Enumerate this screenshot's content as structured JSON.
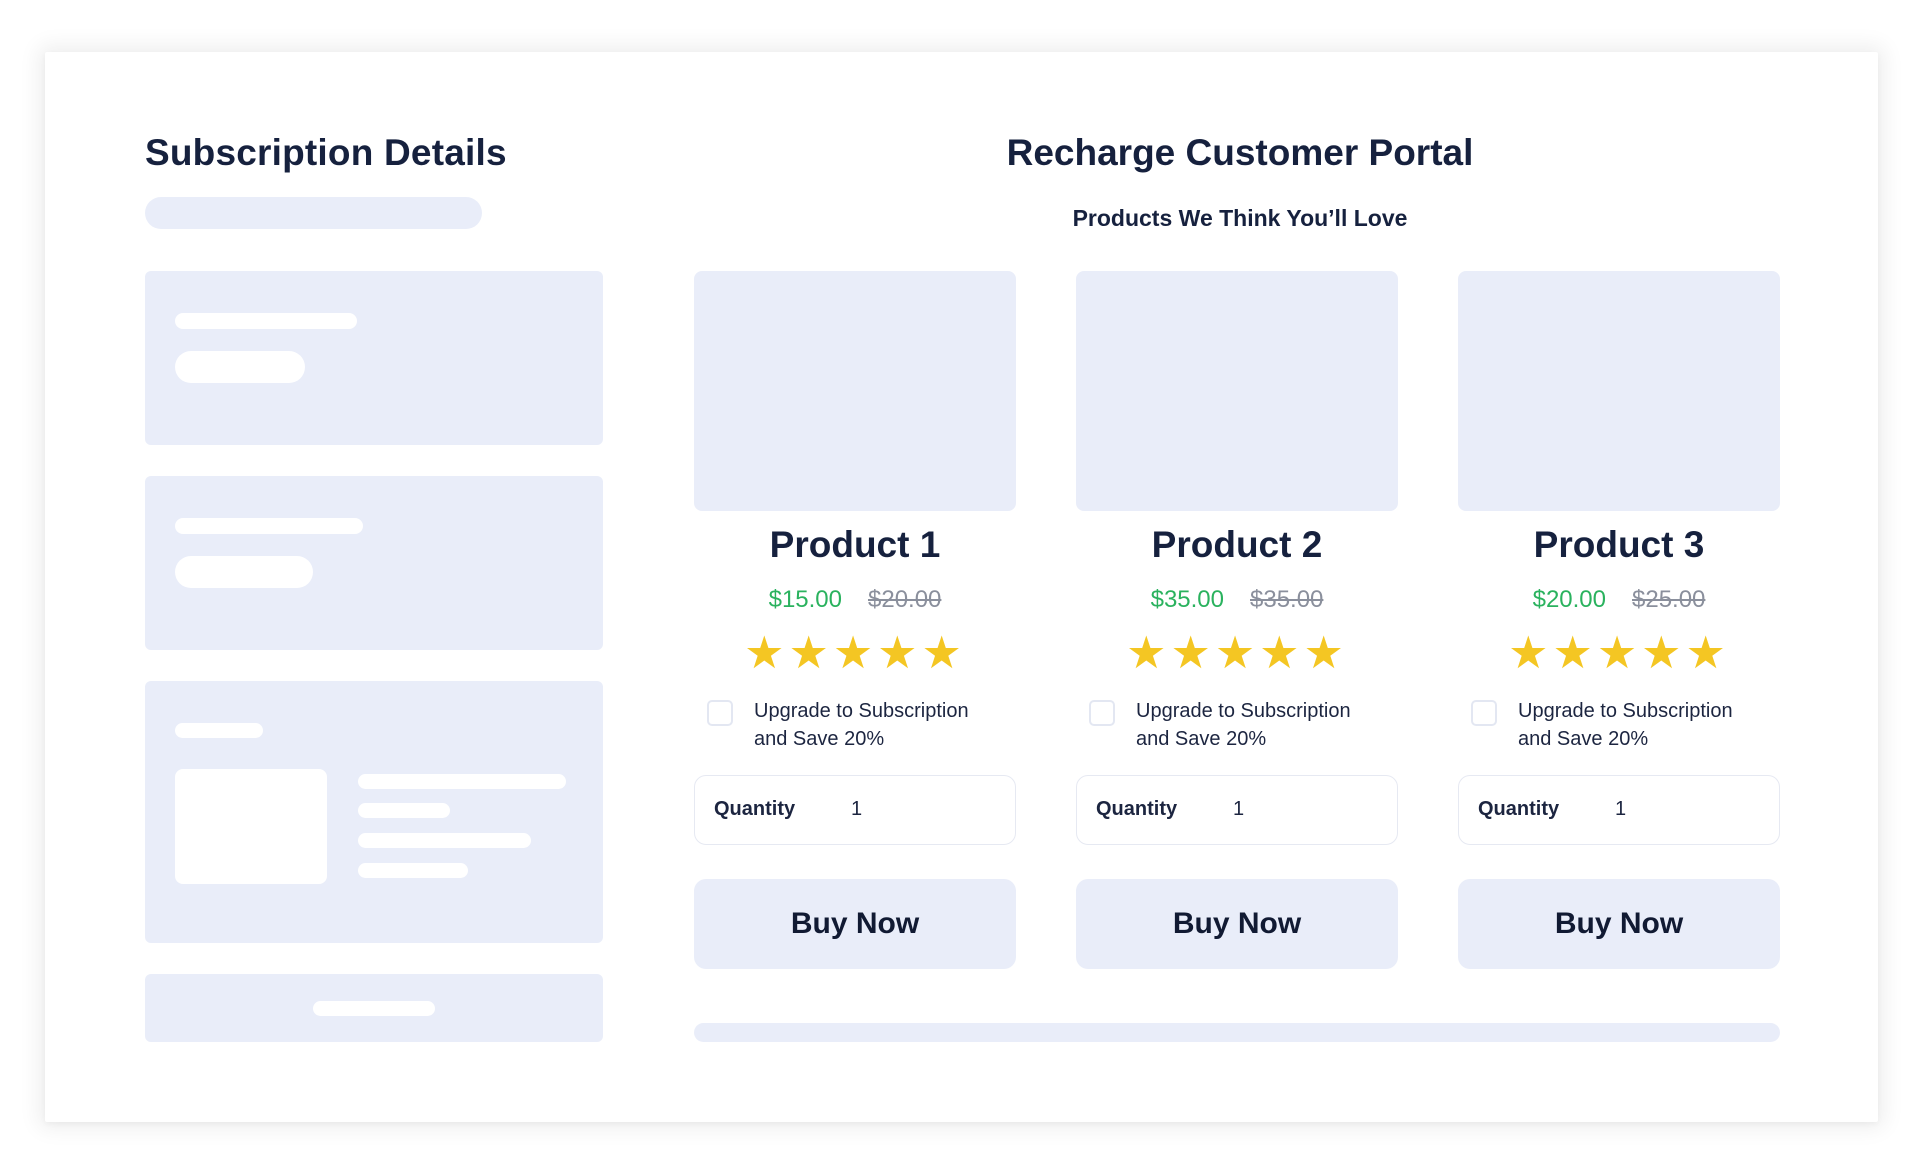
{
  "sidebar": {
    "title": "Subscription Details"
  },
  "portal": {
    "title": "Recharge Customer Portal",
    "subtitle": "Products We Think You’ll Love"
  },
  "colors": {
    "placeholder": "#e9edf9",
    "heading": "#16213e",
    "sale_price": "#2ab25e",
    "original_price": "#8a8f9c",
    "star": "#f4c623"
  },
  "products": [
    {
      "name": "Product 1",
      "price": "$15.00",
      "original_price": "$20.00",
      "rating": 5,
      "stars": "★★★★★",
      "upgrade_line1": "Upgrade to Subscription",
      "upgrade_line2": "and Save 20%",
      "upgrade_checked": false,
      "quantity_label": "Quantity",
      "quantity": "1",
      "buy_label": "Buy Now"
    },
    {
      "name": "Product 2",
      "price": "$35.00",
      "original_price": "$35.00",
      "rating": 5,
      "stars": "★★★★★",
      "upgrade_line1": "Upgrade to Subscription",
      "upgrade_line2": "and Save 20%",
      "upgrade_checked": false,
      "quantity_label": "Quantity",
      "quantity": "1",
      "buy_label": "Buy Now"
    },
    {
      "name": "Product 3",
      "price": "$20.00",
      "original_price": "$25.00",
      "rating": 5,
      "stars": "★★★★★",
      "upgrade_line1": "Upgrade to Subscription",
      "upgrade_line2": "and Save 20%",
      "upgrade_checked": false,
      "quantity_label": "Quantity",
      "quantity": "1",
      "buy_label": "Buy Now"
    }
  ]
}
